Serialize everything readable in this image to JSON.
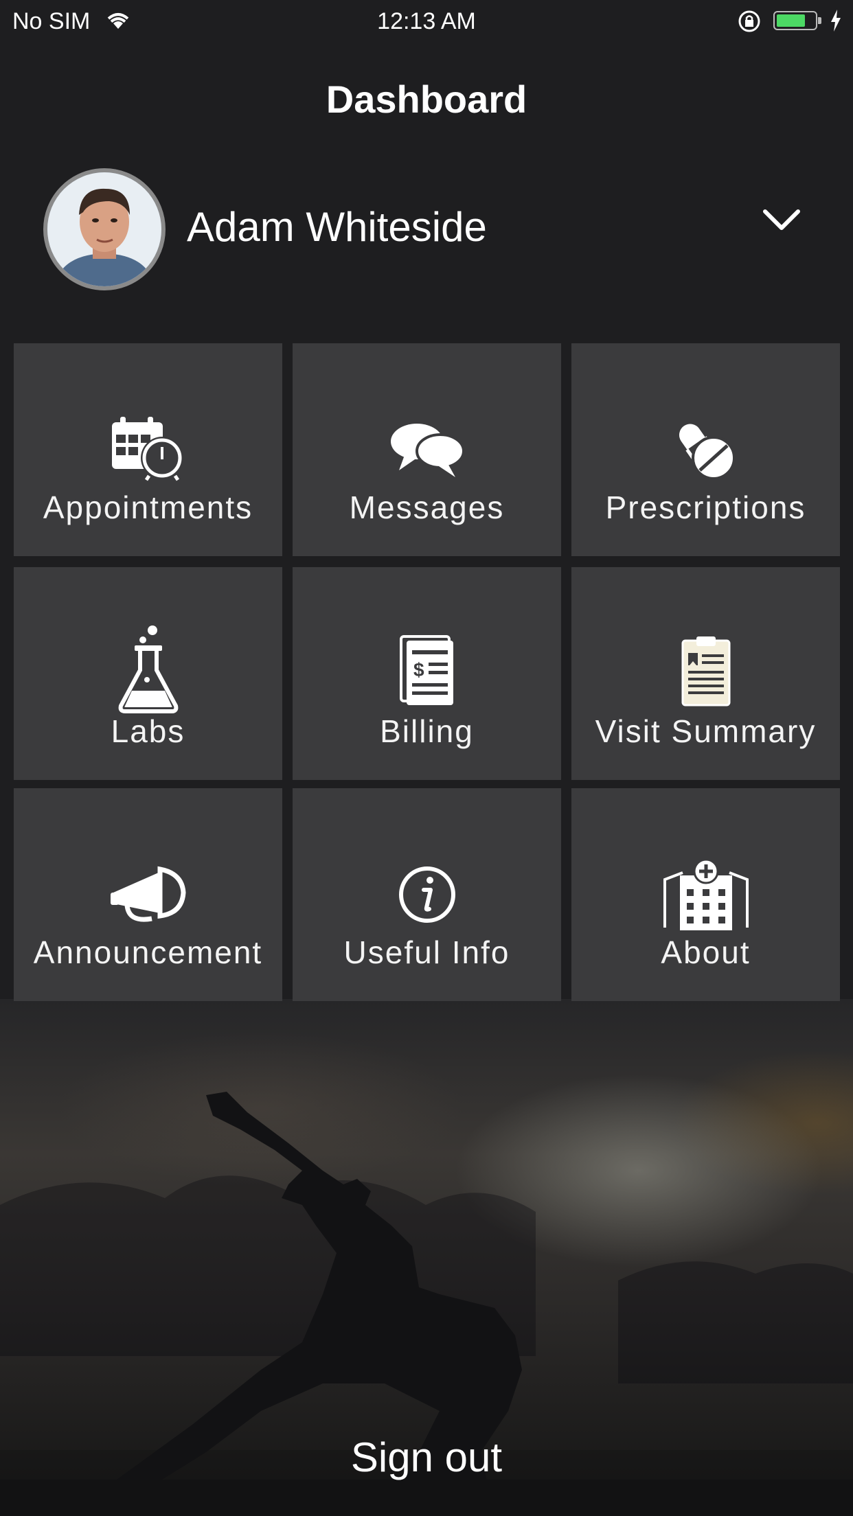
{
  "status_bar": {
    "carrier": "No SIM",
    "time": "12:13 AM",
    "battery_level": 0.75,
    "battery_color": "#4cd964"
  },
  "header": {
    "title": "Dashboard"
  },
  "profile": {
    "name": "Adam Whiteside",
    "avatar_icon": "user-avatar",
    "dropdown_icon": "chevron-down-icon"
  },
  "tiles": [
    {
      "label": "Appointments",
      "icon": "calendar-clock-icon"
    },
    {
      "label": "Messages",
      "icon": "chat-bubbles-icon"
    },
    {
      "label": "Prescriptions",
      "icon": "pills-icon"
    },
    {
      "label": "Labs",
      "icon": "flask-icon"
    },
    {
      "label": "Billing",
      "icon": "bill-icon"
    },
    {
      "label": "Visit Summary",
      "icon": "clipboard-icon"
    },
    {
      "label": "Announcement",
      "icon": "megaphone-icon"
    },
    {
      "label": "Useful Info",
      "icon": "info-icon"
    },
    {
      "label": "About",
      "icon": "hospital-icon"
    }
  ],
  "footer": {
    "signout_label": "Sign out"
  },
  "colors": {
    "background": "#1e1e20",
    "tile": "#3b3b3d",
    "text": "#ffffff"
  }
}
